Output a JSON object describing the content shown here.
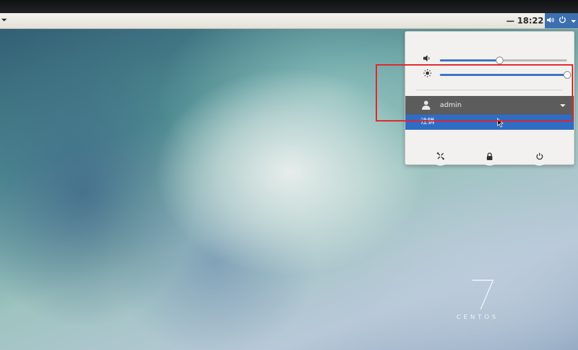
{
  "panel": {
    "activities_arrow": "dropdown",
    "clock": "18:22",
    "clock_prefix": "—",
    "volume_icon": "speaker-icon",
    "power_icon": "power-icon"
  },
  "system_menu": {
    "volume": {
      "icon": "speaker-icon",
      "level": 0.47
    },
    "brightness": {
      "icon": "sun-icon",
      "level": 1.0
    },
    "user": {
      "name": "admin",
      "icon": "user-icon"
    },
    "logout_label": "注销",
    "actions": [
      {
        "name": "settings",
        "icon": "settings-icon"
      },
      {
        "name": "lock",
        "icon": "lock-icon"
      },
      {
        "name": "power-off",
        "icon": "power-icon"
      }
    ]
  },
  "watermark": {
    "number": "7",
    "word": "CENTOS"
  },
  "colors": {
    "accent": "#2f6cc4",
    "panel_bg": "#e4e1d9",
    "menu_bg": "#f2f1ef",
    "user_row_bg": "#5c5c5c",
    "annotation": "#e0262b"
  }
}
